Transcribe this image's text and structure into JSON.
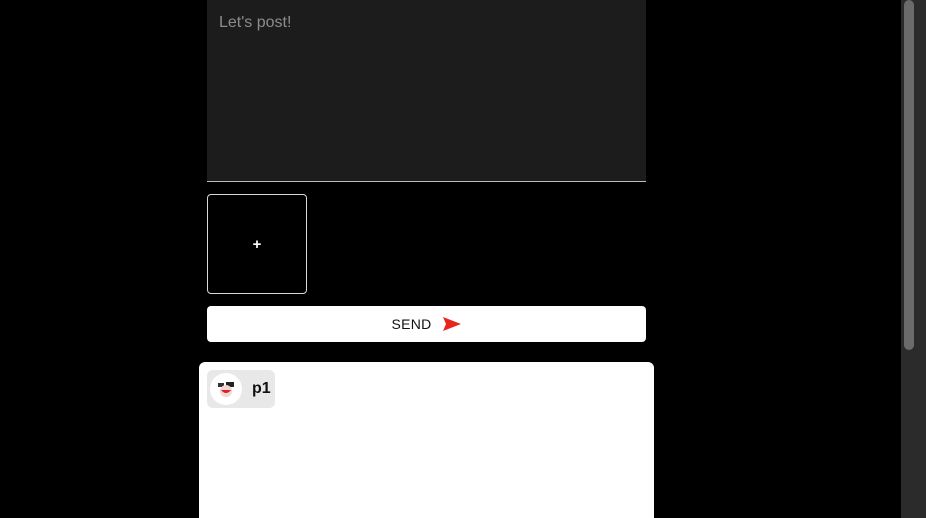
{
  "composer": {
    "placeholder": "Let's post!",
    "add_image_label": "+",
    "send_label": "SEND",
    "send_icon": "send-icon",
    "accent_color": "#e8261c"
  },
  "post": {
    "username": "p1",
    "avatar_icon": "avatar"
  }
}
